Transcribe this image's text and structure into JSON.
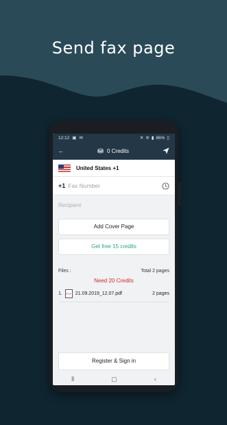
{
  "headline": "Send fax page",
  "status": {
    "time": "12:12",
    "battery": "86%"
  },
  "appbar": {
    "credits": "0 Credits"
  },
  "form": {
    "country": "United States +1",
    "prefix": "+1",
    "fax_placeholder": "Fax Number",
    "recipient_placeholder": "Recipient"
  },
  "buttons": {
    "cover": "Add Cover Page",
    "free": "Get free 15 credits",
    "register": "Register & Sign in"
  },
  "files": {
    "label": "Files :",
    "total": "Total 2 pages",
    "need": "Need 20 Credits",
    "items": [
      {
        "index": "1.",
        "name": "21.09.2019_12.07.pdf",
        "pages": "2 pages"
      }
    ]
  },
  "colors": {
    "bg": "#0f2530",
    "wave": "#2b4a58",
    "appbar": "#243746",
    "accent_green": "#2aa57a",
    "alert_red": "#d8282d"
  },
  "icons": [
    "back-arrow-icon",
    "coins-icon",
    "send-icon",
    "clock-icon",
    "pdf-file-icon"
  ]
}
